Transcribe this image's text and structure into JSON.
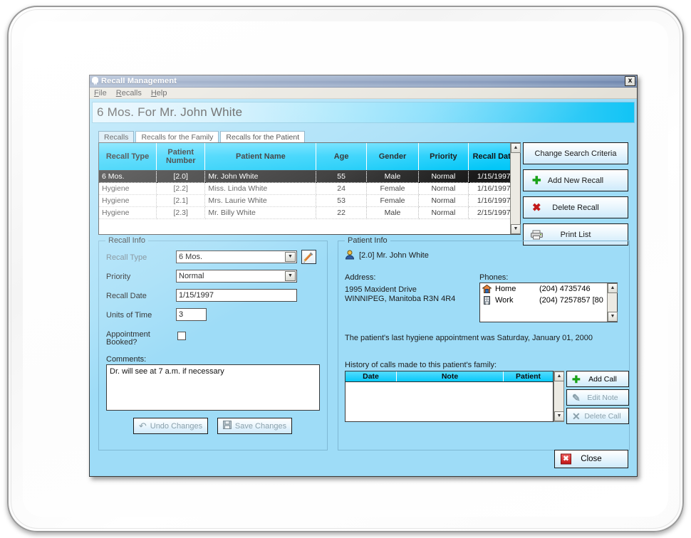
{
  "window": {
    "title": "Recall Management",
    "title_icon": "tooth-icon",
    "close_label": "x",
    "menu": [
      {
        "label": "File",
        "accel": "F"
      },
      {
        "label": "Recalls",
        "accel": "R"
      },
      {
        "label": "Help",
        "accel": "H"
      }
    ],
    "banner": "6 Mos. For Mr. John White"
  },
  "tabs": [
    {
      "label": "Recalls",
      "selected": true
    },
    {
      "label": "Recalls for the Family",
      "selected": false
    },
    {
      "label": "Recalls for the Patient",
      "selected": false
    }
  ],
  "grid": {
    "columns": [
      "Recall Type",
      "Patient Number",
      "Patient Name",
      "Age",
      "Gender",
      "Priority",
      "Recall Date"
    ],
    "rows": [
      {
        "recall_type": "6 Mos.",
        "patient_number": "[2.0]",
        "patient_name": "Mr. John White",
        "age": "55",
        "gender": "Male",
        "priority": "Normal",
        "recall_date": "1/15/1997",
        "selected": true
      },
      {
        "recall_type": "Hygiene",
        "patient_number": "[2.2]",
        "patient_name": "Miss. Linda White",
        "age": "24",
        "gender": "Female",
        "priority": "Normal",
        "recall_date": "1/16/1997",
        "selected": false
      },
      {
        "recall_type": "Hygiene",
        "patient_number": "[2.1]",
        "patient_name": "Mrs. Laurie White",
        "age": "53",
        "gender": "Female",
        "priority": "Normal",
        "recall_date": "1/16/1997",
        "selected": false
      },
      {
        "recall_type": "Hygiene",
        "patient_number": "[2.3]",
        "patient_name": "Mr. Billy White",
        "age": "22",
        "gender": "Male",
        "priority": "Normal",
        "recall_date": "2/15/1997",
        "selected": false
      }
    ],
    "scroll_up": "▲",
    "scroll_down": "▼"
  },
  "actions": [
    {
      "label": "Change Search Criteria",
      "icon": "none"
    },
    {
      "label": "Add New Recall",
      "icon": "plus-icon",
      "glyph": "✚"
    },
    {
      "label": "Delete Recall",
      "icon": "red-x-icon",
      "glyph": "✖"
    },
    {
      "label": "Print List",
      "icon": "printer-icon"
    }
  ],
  "recall_info": {
    "legend": "Recall Info",
    "fields": {
      "recall_type_label": "Recall Type",
      "recall_type_value": "6 Mos.",
      "priority_label": "Priority",
      "priority_value": "Normal",
      "recall_date_label": "Recall Date",
      "recall_date_value": "1/15/1997",
      "units_label": "Units of Time",
      "units_value": "3",
      "appointment_label_l1": "Appointment",
      "appointment_label_l2": "Booked?",
      "appointment_checked": false,
      "comments_label": "Comments:",
      "comments_value": "Dr. will see at 7 a.m. if necessary"
    },
    "buttons": [
      {
        "label": "Undo Changes",
        "icon": "undo-icon",
        "glyph": "↶",
        "disabled": true
      },
      {
        "label": "Save Changes",
        "icon": "save-disk-icon",
        "disabled": true
      }
    ],
    "dropdown_arrow": "▼",
    "edit_icon": "pencil-icon"
  },
  "patient_info": {
    "legend": "Patient Info",
    "patient_icon": "person-icon",
    "patient_line": "[2.0] Mr. John White",
    "address_label": "Address:",
    "address_lines": [
      "1995 Maxident Drive",
      "WINNIPEG, Manitoba  R3N 4R4"
    ],
    "phones_label": "Phones:",
    "phones": [
      {
        "icon": "home-icon",
        "type": "Home",
        "number": "(204) 4735746"
      },
      {
        "icon": "office-icon",
        "type": "Work",
        "number": "(204)  7257857 [80"
      }
    ],
    "last_appointment": "The patient's last hygiene appointment was Saturday, January 01, 2000",
    "history_label": "History of calls made to this patient's family:",
    "call_columns": [
      "Date",
      "Note",
      "Patient"
    ],
    "call_rows": [],
    "call_buttons": [
      {
        "label": "Add Call",
        "icon": "plus-icon",
        "glyph": "✚",
        "disabled": false
      },
      {
        "label": "Edit Note",
        "icon": "pencil-icon",
        "glyph": "✎",
        "disabled": true
      },
      {
        "label": "Delete Call",
        "icon": "x-icon",
        "glyph": "✕",
        "disabled": true
      }
    ],
    "scroll_up": "▲",
    "scroll_down": "▼"
  },
  "footer": {
    "close_label": "Close",
    "close_icon": "red-close-icon",
    "close_glyph": "✖"
  },
  "colors": {
    "window_bg": "#9edcf7",
    "grid_header": "#18cdfb",
    "selected_row": "#1a1a1a",
    "accent_green": "#18a218",
    "accent_red": "#c21a1a"
  }
}
